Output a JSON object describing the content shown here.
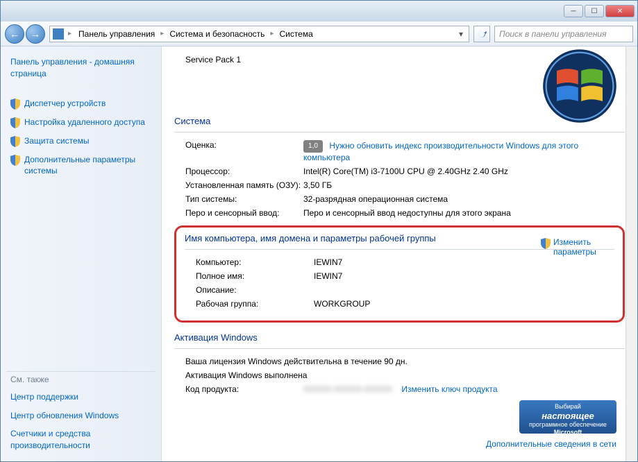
{
  "titlebar": {
    "min": "─",
    "max": "☐",
    "close": "✕"
  },
  "nav": {
    "back": "←",
    "fwd": "→",
    "crumbs": [
      "Панель управления",
      "Система и безопасность",
      "Система"
    ],
    "search_placeholder": "Поиск в панели управления"
  },
  "sidebar": {
    "home": "Панель управления - домашняя страница",
    "links": [
      "Диспетчер устройств",
      "Настройка удаленного доступа",
      "Защита системы",
      "Дополнительные параметры системы"
    ],
    "see_also_hdr": "См. также",
    "see_also": [
      "Центр поддержки",
      "Центр обновления Windows",
      "Счетчики и средства производительности"
    ]
  },
  "content": {
    "service_pack": "Service Pack 1",
    "sys_hdr": "Система",
    "rows": {
      "rating_label": "Оценка:",
      "rating_val": "1,0",
      "rating_link": "Нужно обновить индекс производительности Windows для этого компьютера",
      "cpu_label": "Процессор:",
      "cpu_val": "Intel(R) Core(TM) i3-7100U CPU @ 2.40GHz   2.40 GHz",
      "ram_label": "Установленная память (ОЗУ):",
      "ram_val": "3,50 ГБ",
      "type_label": "Тип системы:",
      "type_val": "32-разрядная операционная система",
      "pen_label": "Перо и сенсорный ввод:",
      "pen_val": "Перо и сенсорный ввод недоступны для этого экрана"
    },
    "domain_hdr": "Имя компьютера, имя домена и параметры рабочей группы",
    "domain": {
      "pc_label": "Компьютер:",
      "pc_val": "IEWIN7",
      "full_label": "Полное имя:",
      "full_val": "IEWIN7",
      "desc_label": "Описание:",
      "desc_val": "",
      "wg_label": "Рабочая группа:",
      "wg_val": "WORKGROUP",
      "change": "Изменить параметры"
    },
    "act_hdr": "Активация Windows",
    "activation": {
      "line1": "Ваша лицензия Windows действительна в течение 90 дн.",
      "line2": "Активация Windows выполнена",
      "key_label": "Код продукта:",
      "key_link": "Изменить ключ продукта"
    },
    "oem": {
      "l1": "Выбирай",
      "l2": "настоящее",
      "l3": "программное обеспечение",
      "l4": "Microsoft"
    },
    "more_link": "Дополнительные сведения в сети"
  }
}
